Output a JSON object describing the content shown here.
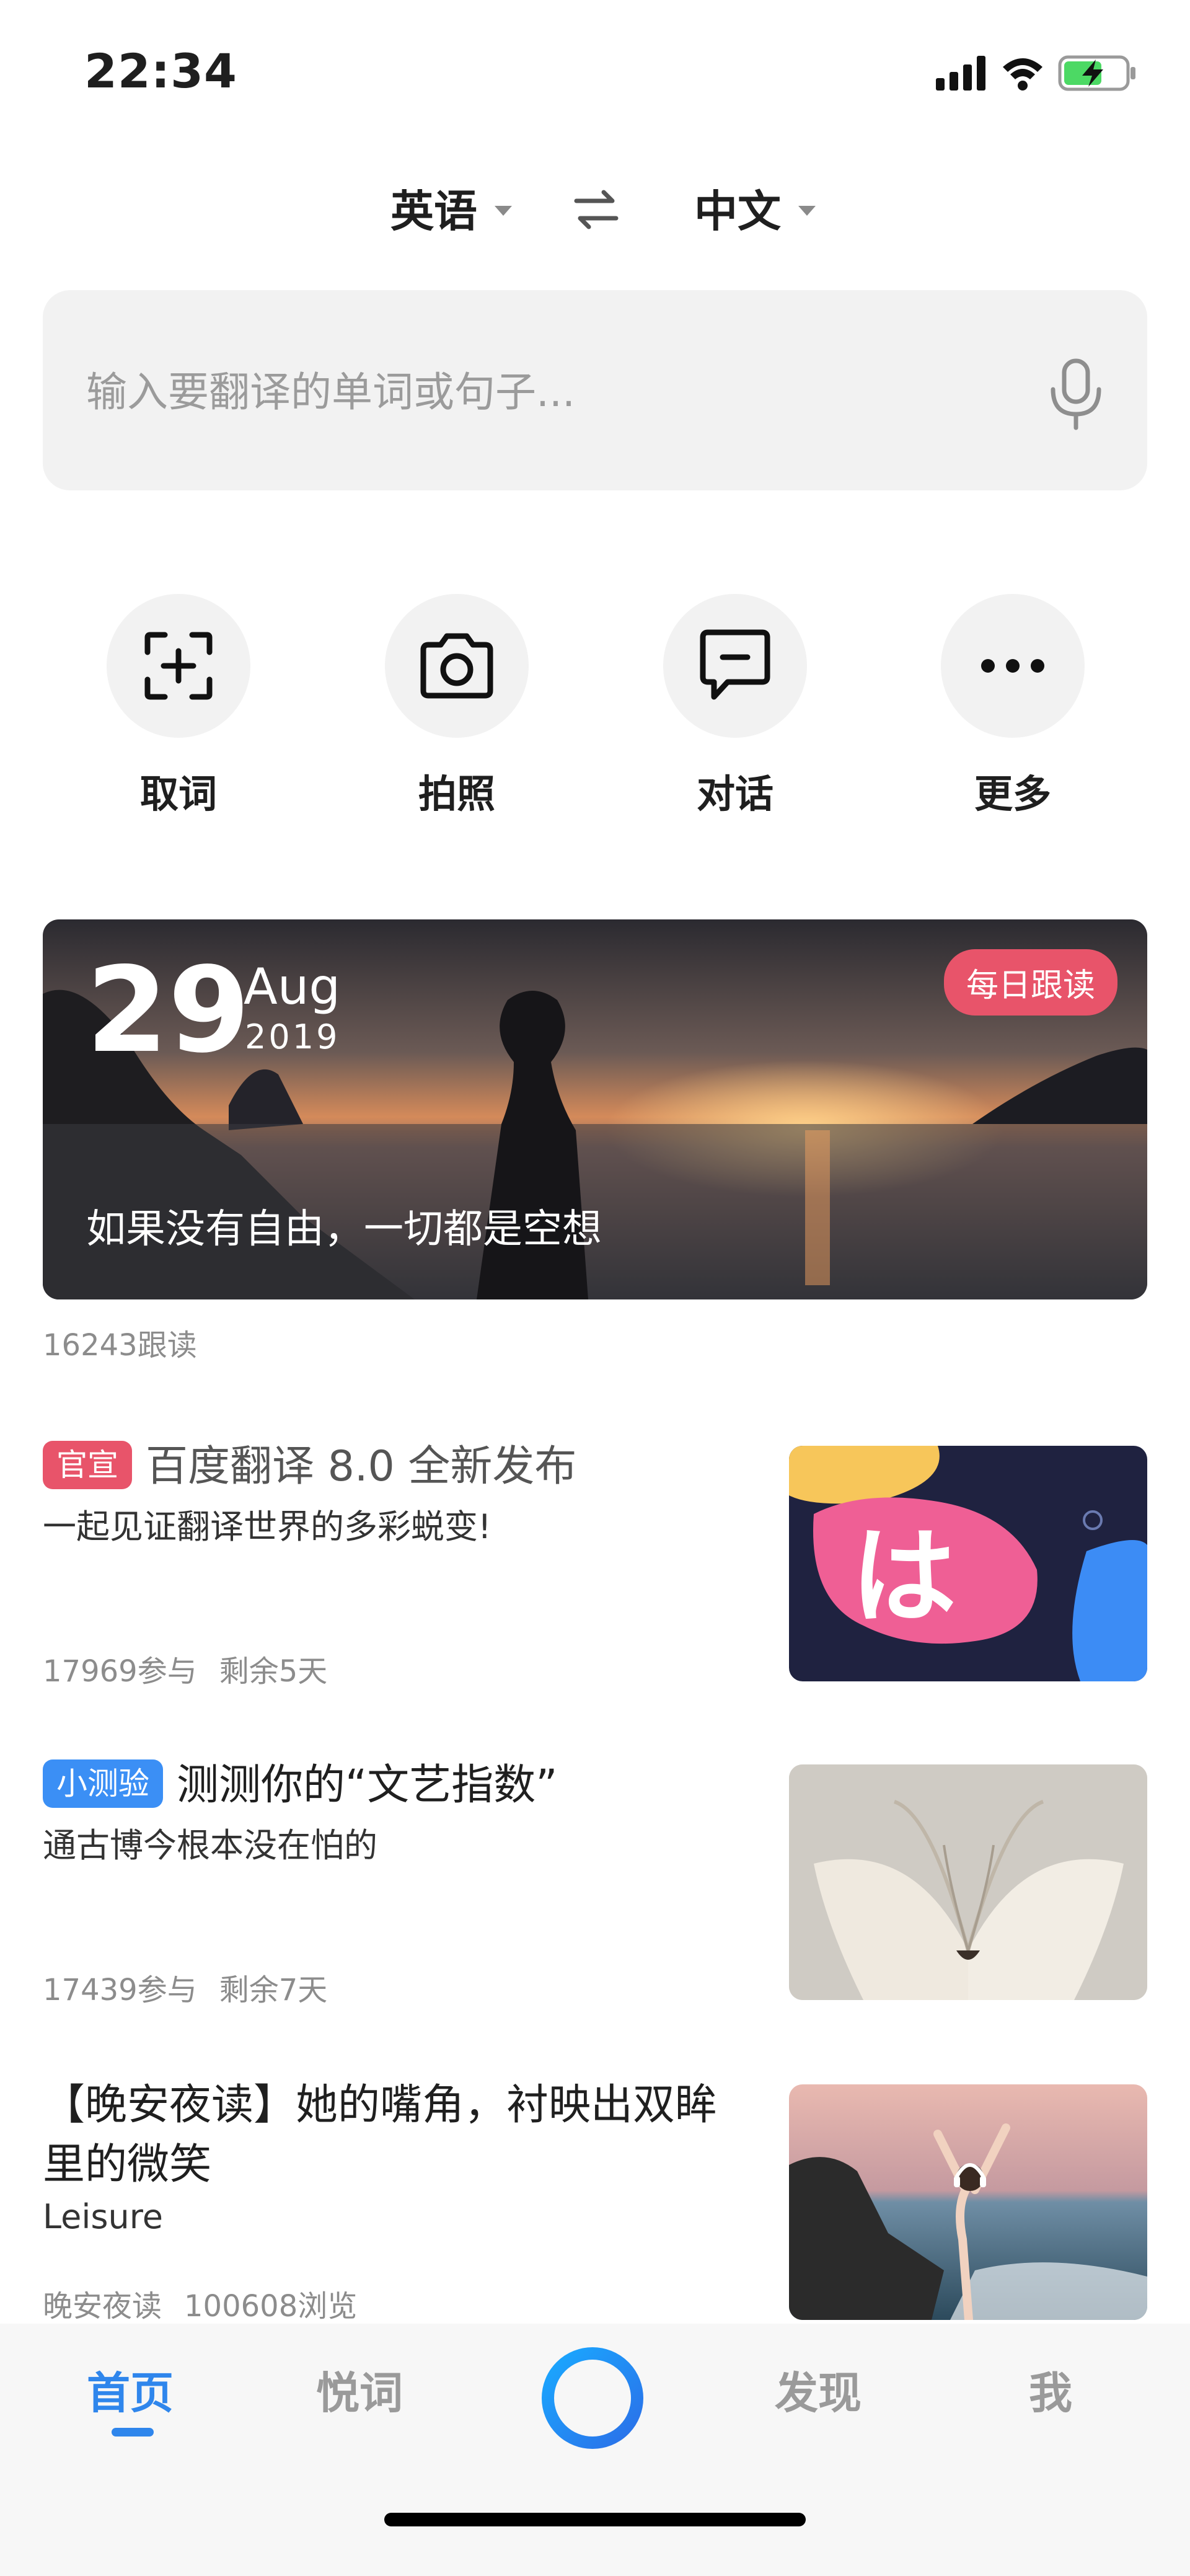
{
  "status": {
    "time": "22:34",
    "icons": [
      "signal-icon",
      "wifi-icon",
      "battery-charging-icon"
    ]
  },
  "languages": {
    "source": "英语",
    "target": "中文"
  },
  "search": {
    "placeholder": "输入要翻译的单词或句子..."
  },
  "tools": [
    {
      "label": "取词",
      "icon": "scan-add-icon"
    },
    {
      "label": "拍照",
      "icon": "camera-icon"
    },
    {
      "label": "对话",
      "icon": "chat-icon"
    },
    {
      "label": "更多",
      "icon": "more-icon"
    }
  ],
  "daily": {
    "day": "29",
    "month": "Aug",
    "year": "2019",
    "badge": "每日跟读",
    "quote": "如果没有自由，一切都是空想",
    "count": "16243跟读"
  },
  "feed": [
    {
      "tag": "官宣",
      "title": "百度翻译 8.0 全新发布",
      "subtitle": "一起见证翻译世界的多彩蜕变!",
      "participants": "17969参与",
      "remaining": "剩余5天"
    },
    {
      "tag": "小测验",
      "title": "测测你的“文艺指数”",
      "subtitle": "通古博今根本没在怕的",
      "participants": "17439参与",
      "remaining": "剩余7天"
    },
    {
      "title": "【晚安夜读】她的嘴角，衬映出双眸里的微笑",
      "subtitle": "Leisure",
      "source": "晚安夜读",
      "views": "100608浏览"
    }
  ],
  "thumb_text": "は",
  "nav": {
    "items": [
      "首页",
      "悦词",
      "发现",
      "我"
    ],
    "active": "首页"
  },
  "colors": {
    "accent": "#2f86ec",
    "tag_red": "#e8546a",
    "tag_blue": "#3b8ff5"
  }
}
